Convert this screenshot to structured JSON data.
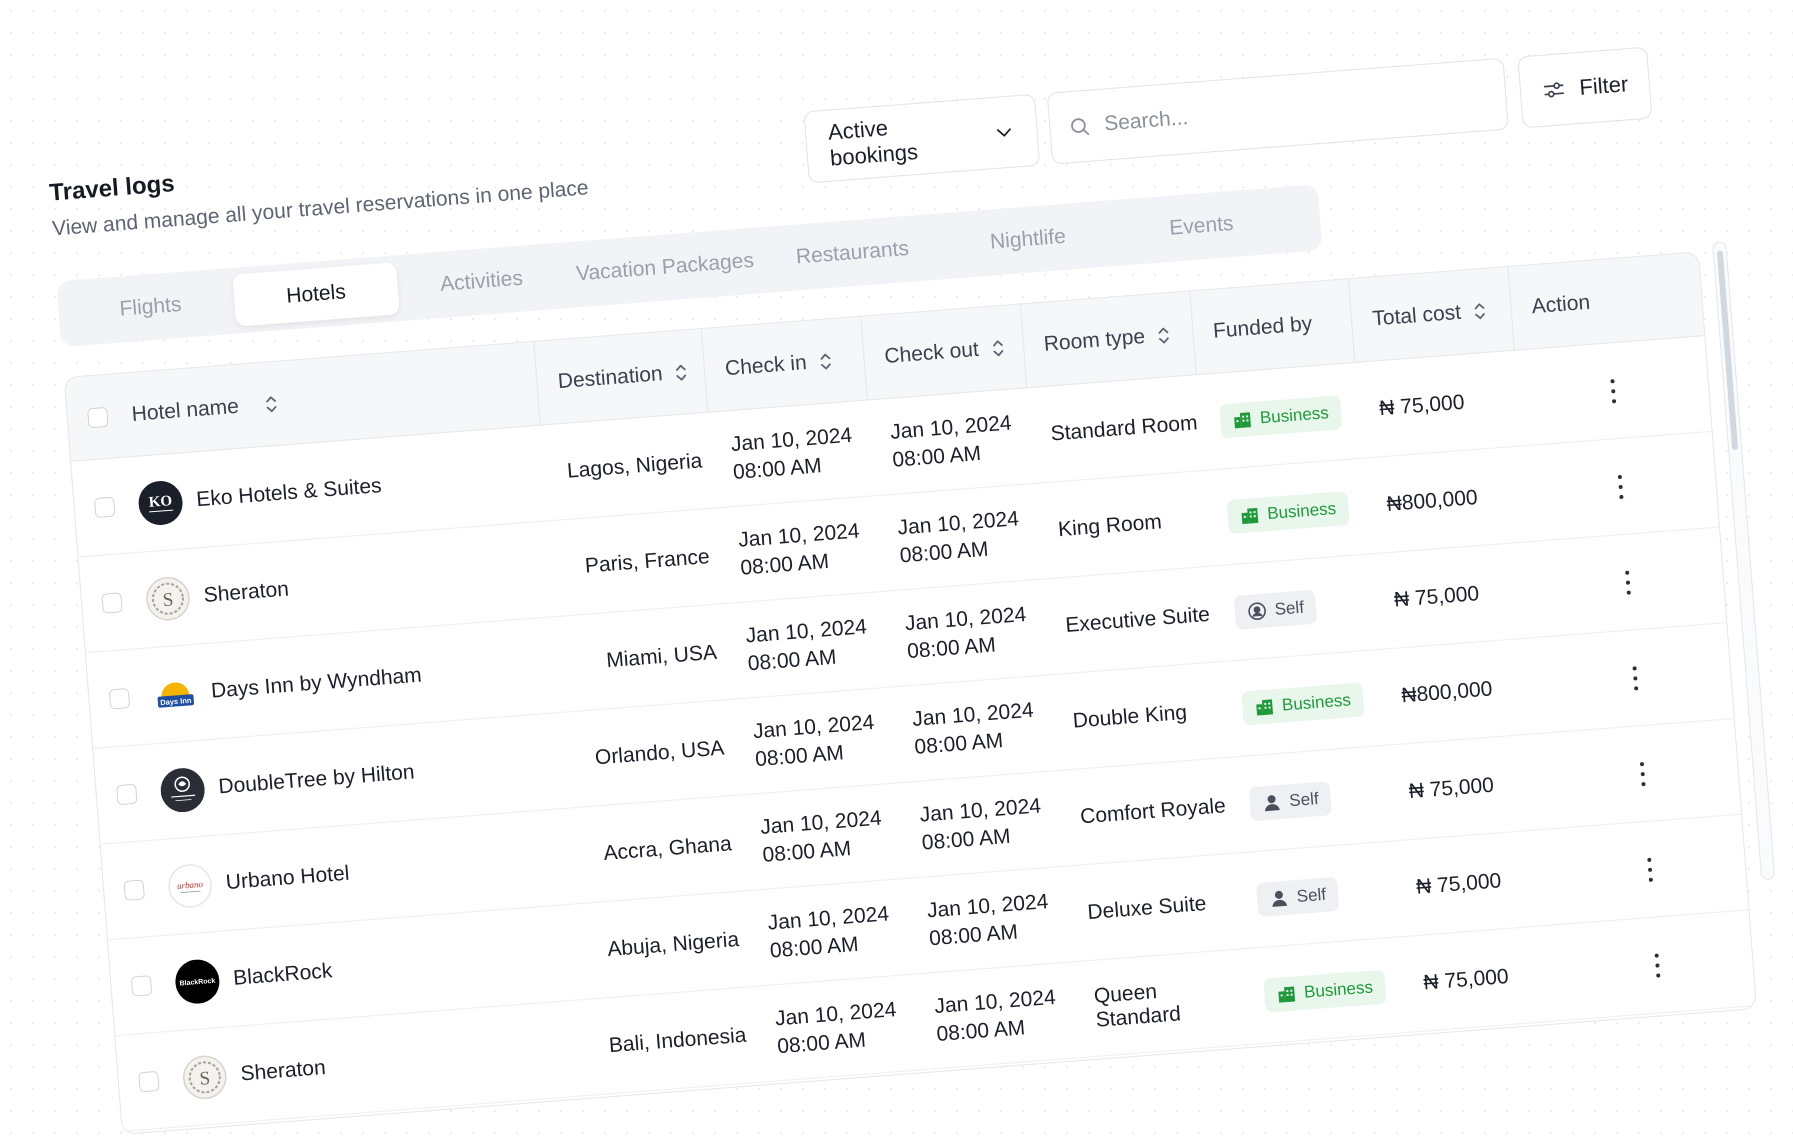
{
  "header": {
    "title": "Travel logs",
    "subtitle": "View and manage all your travel reservations in one place"
  },
  "toolbar": {
    "bookings_select": "Active bookings",
    "search_placeholder": "Search...",
    "filter_label": "Filter"
  },
  "tabs": [
    {
      "label": "Flights",
      "active": false
    },
    {
      "label": "Hotels",
      "active": true
    },
    {
      "label": "Activities",
      "active": false
    },
    {
      "label": "Vacation Packages",
      "active": false
    },
    {
      "label": "Restaurants",
      "active": false
    },
    {
      "label": "Nightlife",
      "active": false
    },
    {
      "label": "Events",
      "active": false
    }
  ],
  "table": {
    "columns": {
      "hotel_name": "Hotel name",
      "destination": "Destination",
      "check_in": "Check in",
      "check_out": "Check out",
      "room_type": "Room type",
      "funded_by": "Funded by",
      "total_cost": "Total cost",
      "action": "Action"
    },
    "rows": [
      {
        "hotel": "Eko Hotels & Suites",
        "logo": "eko-logo",
        "destination": "Lagos, Nigeria",
        "check_in_date": "Jan 10, 2024",
        "check_in_time": "08:00 AM",
        "check_out_date": "Jan 10, 2024",
        "check_out_time": "08:00 AM",
        "room": "Standard Room",
        "funded": "Business",
        "funded_icon": "building-icon",
        "cost": "₦ 75,000"
      },
      {
        "hotel": "Sheraton",
        "logo": "sheraton-logo",
        "destination": "Paris, France",
        "check_in_date": "Jan 10, 2024",
        "check_in_time": "08:00 AM",
        "check_out_date": "Jan 10, 2024",
        "check_out_time": "08:00 AM",
        "room": "King Room",
        "funded": "Business",
        "funded_icon": "building-icon",
        "cost": "₦800,000"
      },
      {
        "hotel": "Days Inn by Wyndham",
        "logo": "days-inn-logo",
        "destination": "Miami, USA",
        "check_in_date": "Jan 10, 2024",
        "check_in_time": "08:00 AM",
        "check_out_date": "Jan 10, 2024",
        "check_out_time": "08:00 AM",
        "room": "Executive Suite",
        "funded": "Self",
        "funded_icon": "user-circle-icon",
        "cost": "₦ 75,000"
      },
      {
        "hotel": "DoubleTree by Hilton",
        "logo": "doubletree-logo",
        "destination": "Orlando, USA",
        "check_in_date": "Jan 10, 2024",
        "check_in_time": "08:00 AM",
        "check_out_date": "Jan 10, 2024",
        "check_out_time": "08:00 AM",
        "room": "Double King",
        "funded": "Business",
        "funded_icon": "building-icon",
        "cost": "₦800,000"
      },
      {
        "hotel": "Urbano Hotel",
        "logo": "urbano-logo",
        "destination": "Accra, Ghana",
        "check_in_date": "Jan 10, 2024",
        "check_in_time": "08:00 AM",
        "check_out_date": "Jan 10, 2024",
        "check_out_time": "08:00 AM",
        "room": "Comfort Royale",
        "funded": "Self",
        "funded_icon": "user-icon",
        "cost": "₦ 75,000"
      },
      {
        "hotel": "BlackRock",
        "logo": "blackrock-logo",
        "destination": "Abuja, Nigeria",
        "check_in_date": "Jan 10, 2024",
        "check_in_time": "08:00 AM",
        "check_out_date": "Jan 10, 2024",
        "check_out_time": "08:00 AM",
        "room": "Deluxe Suite",
        "funded": "Self",
        "funded_icon": "user-icon",
        "cost": "₦ 75,000"
      },
      {
        "hotel": "Sheraton",
        "logo": "sheraton-logo",
        "destination": "Bali, Indonesia",
        "check_in_date": "Jan 10, 2024",
        "check_in_time": "08:00 AM",
        "check_out_date": "Jan 10, 2024",
        "check_out_time": "08:00 AM",
        "room": "Queen Standard",
        "funded": "Business",
        "funded_icon": "building-icon",
        "cost": "₦ 75,000"
      }
    ]
  },
  "logos": {
    "eko": "KO",
    "days_inn": "Days Inn",
    "blackrock": "BlackRock",
    "urbano": "urbano",
    "sheraton": "S"
  },
  "colors": {
    "business_green": "#1f9a3a",
    "business_bg": "#e9f6ec",
    "self_bg": "#eef0f3",
    "border": "#e3e6eb",
    "muted_text": "#9aa0ab"
  }
}
